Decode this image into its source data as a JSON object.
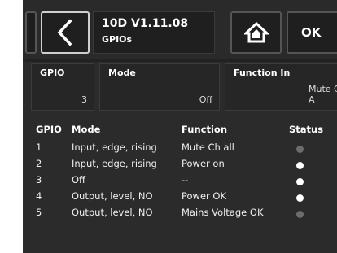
{
  "header": {
    "version": "10D V1.11.08",
    "page": "GPIOs",
    "back_icon": "chevron-left-icon",
    "home_icon": "home-icon",
    "ok_label": "OK"
  },
  "fields": {
    "gpio": {
      "label": "GPIO",
      "value": "3"
    },
    "mode": {
      "label": "Mode",
      "value": "Off"
    },
    "function_in": {
      "label": "Function In",
      "value": "Mute Ch A"
    }
  },
  "table": {
    "headers": {
      "gpio": "GPIO",
      "mode": "Mode",
      "function": "Function",
      "status": "Status"
    },
    "rows": [
      {
        "gpio": "1",
        "mode": "Input, edge, rising",
        "function": "Mute Ch all",
        "status": "off"
      },
      {
        "gpio": "2",
        "mode": "Input, edge, rising",
        "function": "Power on",
        "status": "on"
      },
      {
        "gpio": "3",
        "mode": "Off",
        "function": "--",
        "status": "on"
      },
      {
        "gpio": "4",
        "mode": "Output, level, NO",
        "function": "Power OK",
        "status": "on"
      },
      {
        "gpio": "5",
        "mode": "Output, level, NO",
        "function": "Mains Voltage OK",
        "status": "off"
      }
    ]
  },
  "colors": {
    "status_on": "#ffffff",
    "status_off": "#6c6c6c",
    "background": "#2b2b2b"
  }
}
